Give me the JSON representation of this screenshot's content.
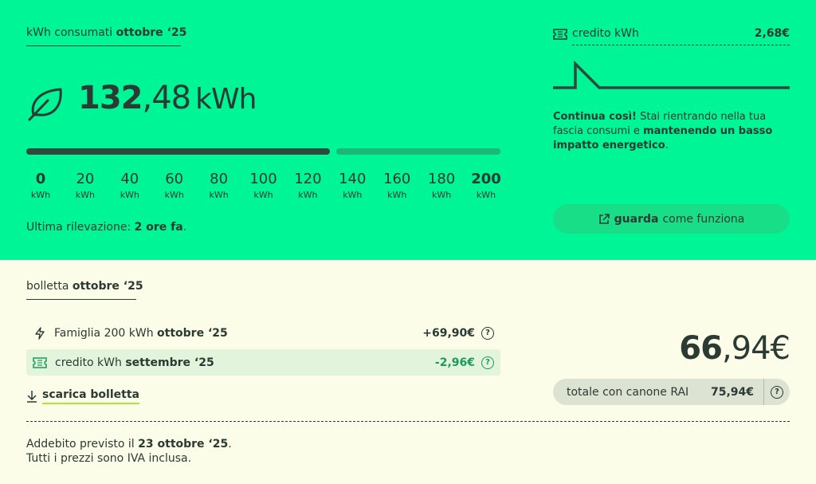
{
  "consumption": {
    "header_prefix": "kWh consumati",
    "header_period": "ottobre ‘25",
    "value_int": "132",
    "value_dec": ",48",
    "value_unit": "kWh",
    "progress_fraction": 0.66,
    "ticks": [
      {
        "value": "0",
        "unit": "kWh",
        "bold": true
      },
      {
        "value": "20",
        "unit": "kWh"
      },
      {
        "value": "40",
        "unit": "kWh"
      },
      {
        "value": "60",
        "unit": "kWh"
      },
      {
        "value": "80",
        "unit": "kWh"
      },
      {
        "value": "100",
        "unit": "kWh"
      },
      {
        "value": "120",
        "unit": "kWh"
      },
      {
        "value": "140",
        "unit": "kWh"
      },
      {
        "value": "160",
        "unit": "kWh"
      },
      {
        "value": "180",
        "unit": "kWh"
      },
      {
        "value": "200",
        "unit": "kWh",
        "bold": true
      }
    ],
    "last_reading_label": "Ultima rilevazione:",
    "last_reading_value": "2 ore fa",
    "last_reading_suffix": "."
  },
  "credit": {
    "label": "credito kWh",
    "value": "2,68€",
    "message_bold1": "Continua così!",
    "message_text1": " Stai rientrando nella tua fascia consumi e ",
    "message_bold2": "mantenendo un basso impatto energetico",
    "message_text2": ".",
    "button_bold": "guarda",
    "button_text": "come funziona"
  },
  "bill": {
    "header_prefix": "bolletta",
    "header_period": "ottobre ‘25",
    "lines": [
      {
        "label": "Famiglia 200 kWh",
        "period": "ottobre ‘25",
        "amount": "+69,90€",
        "icon": "bolt-icon"
      },
      {
        "label": "credito kWh",
        "period": "settembre ‘25",
        "amount": "-2,96€",
        "icon": "ticket-icon"
      }
    ],
    "download_label": "scarica bolletta",
    "total_int": "66",
    "total_dec": ",94€",
    "rai_label": "totale con canone RAI",
    "rai_value": "75,94€",
    "help_glyph": "?",
    "footer_line1_prefix": "Addebito previsto il ",
    "footer_line1_date": "23 ottobre ‘25",
    "footer_line1_suffix": ".",
    "footer_line2": "Tutti i prezzi sono IVA inclusa."
  },
  "colors": {
    "top_bg": "#00f596",
    "bottom_bg": "#fbfde8",
    "text": "#2b3a33",
    "credit_green": "#1b9a5a"
  }
}
